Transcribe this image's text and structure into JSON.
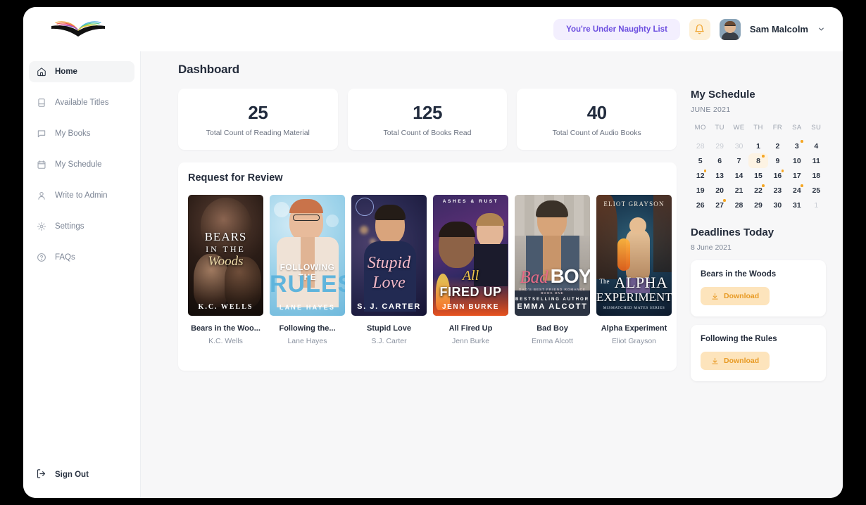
{
  "header": {
    "logo_name": "open-book-logo",
    "status_pill": "You're Under Naughty List",
    "bell_icon": "bell-icon",
    "avatar_name": "user-avatar",
    "user_name": "Sam Malcolm",
    "chevron": "∨"
  },
  "sidebar": {
    "items": [
      {
        "label": "Home",
        "icon": "home-icon",
        "active": true
      },
      {
        "label": "Available Titles",
        "icon": "book-icon",
        "active": false
      },
      {
        "label": "My Books",
        "icon": "chat-bubble-icon",
        "active": false
      },
      {
        "label": "My Schedule",
        "icon": "calendar-icon",
        "active": false
      },
      {
        "label": "Write to Admin",
        "icon": "user-icon",
        "active": false
      },
      {
        "label": "Settings",
        "icon": "gear-icon",
        "active": false
      },
      {
        "label": "FAQs",
        "icon": "question-circle-icon",
        "active": false
      }
    ],
    "signout": {
      "label": "Sign Out",
      "icon": "sign-out-icon"
    }
  },
  "main": {
    "page_title": "Dashboard",
    "stats": [
      {
        "value": "25",
        "label": "Total Count of Reading Material"
      },
      {
        "value": "125",
        "label": "Total Count of Books Read"
      },
      {
        "value": "40",
        "label": "Total Count of Audio Books"
      }
    ],
    "review": {
      "title": "Request for Review",
      "books": [
        {
          "title": "Bears in the Woo...",
          "author": "K.C. Wells",
          "cover": {
            "line1": "BEARS",
            "line2": "IN THE",
            "line3": "Woods",
            "author_line": "K.C. WELLS"
          }
        },
        {
          "title": "Following the...",
          "author": "Lane Hayes",
          "cover": {
            "line1": "FOLLOWING THE",
            "line2": "RULES",
            "author_line": "LANE HAYES"
          }
        },
        {
          "title": "Stupid Love",
          "author": "S.J. Carter",
          "cover": {
            "line1": "Stupid",
            "line2": "Love",
            "author_line": "S. J. CARTER"
          }
        },
        {
          "title": "All Fired Up",
          "author": "Jenn Burke",
          "cover": {
            "banner": "ASHES & RUST",
            "line1": "All",
            "line2": "FIRED UP",
            "author_line": "JENN BURKE"
          }
        },
        {
          "title": "Bad Boy",
          "author": "Emma Alcott",
          "cover": {
            "line1": "Bad",
            "line2": "BOY",
            "line3": "DAD'S BEST FRIEND ROMANCE  BOOK ONE",
            "pre_author": "BESTSELLING AUTHOR",
            "author_line": "EMMA ALCOTT"
          }
        },
        {
          "title": "Alpha Experiment",
          "author": "Eliot Grayson",
          "cover": {
            "top_author": "ELIOT GRAYSON",
            "line1": "The",
            "line2": "ALPHA",
            "line3": "EXPERIMENT",
            "line4": "MISMATCHED MATES SERIES"
          }
        }
      ]
    }
  },
  "schedule": {
    "title": "My Schedule",
    "month": "JUNE 2021",
    "weekdays": [
      "MO",
      "TU",
      "WE",
      "TH",
      "FR",
      "SA",
      "SU"
    ],
    "weeks": [
      [
        {
          "d": "28",
          "mute": true
        },
        {
          "d": "29",
          "mute": true
        },
        {
          "d": "30",
          "mute": true
        },
        {
          "d": "1"
        },
        {
          "d": "2"
        },
        {
          "d": "3",
          "dot": true
        },
        {
          "d": "4"
        }
      ],
      [
        {
          "d": "5"
        },
        {
          "d": "6"
        },
        {
          "d": "7"
        },
        {
          "d": "8",
          "dot": true,
          "selected": true
        },
        {
          "d": "9"
        },
        {
          "d": "10"
        },
        {
          "d": "11"
        }
      ],
      [
        {
          "d": "12",
          "dot": true
        },
        {
          "d": "13"
        },
        {
          "d": "14"
        },
        {
          "d": "15"
        },
        {
          "d": "16",
          "dot": true
        },
        {
          "d": "17"
        },
        {
          "d": "18"
        }
      ],
      [
        {
          "d": "19"
        },
        {
          "d": "20"
        },
        {
          "d": "21"
        },
        {
          "d": "22",
          "dot": true
        },
        {
          "d": "23"
        },
        {
          "d": "24",
          "dot": true
        },
        {
          "d": "25"
        }
      ],
      [
        {
          "d": "26"
        },
        {
          "d": "27",
          "dot": true
        },
        {
          "d": "28"
        },
        {
          "d": "29"
        },
        {
          "d": "30"
        },
        {
          "d": "31"
        },
        {
          "d": "1",
          "mute": true
        }
      ]
    ]
  },
  "deadlines": {
    "title": "Deadlines Today",
    "date": "8 June 2021",
    "items": [
      {
        "name": "Bears in the Woods",
        "button": "Download",
        "icon": "download-icon"
      },
      {
        "name": "Following the Rules",
        "button": "Download",
        "icon": "download-icon"
      }
    ]
  },
  "colors": {
    "accent_purple": "#6c4ee0",
    "accent_orange": "#f5a623",
    "page_bg": "#f7f7f8",
    "card_bg": "#ffffff",
    "text_dark": "#242c3b",
    "text_muted": "#7b8494"
  }
}
